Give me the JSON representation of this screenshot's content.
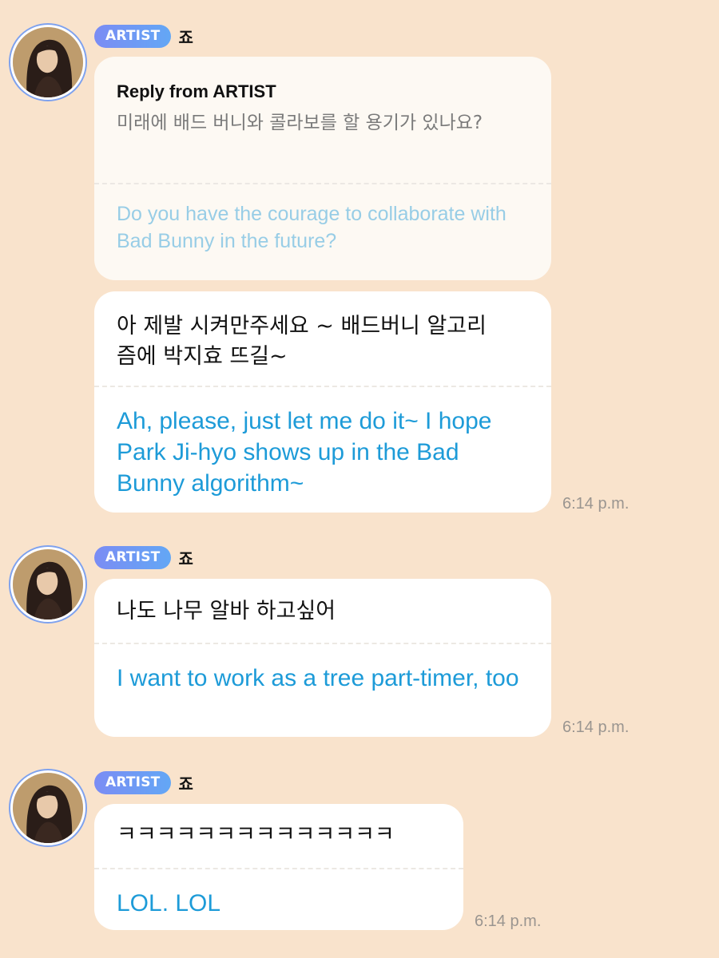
{
  "accent_colors": {
    "badge_start": "#7b8cf4",
    "badge_end": "#63a7f5",
    "translation_text": "#1d9bd8",
    "quoted_translation": "#98cde6",
    "background": "#f9e3cc"
  },
  "groups": [
    {
      "badge": "ARTIST",
      "name": "죠",
      "avatar_icon": "profile-photo",
      "reply": {
        "title": "Reply from ARTIST",
        "korean": "미래에 배드 버니와 콜라보를 할 용기가 있나요?",
        "english": "Do you have the courage to collaborate with Bad Bunny in the future?"
      },
      "message": {
        "korean": "아 제발 시켜만주세요 ~ 배드버니 알고리즘에 박지효 뜨길~",
        "english": "Ah, please, just let me do it~ I hope Park Ji-hyo shows up in the Bad Bunny algorithm~"
      },
      "time": "6:14 p.m."
    },
    {
      "badge": "ARTIST",
      "name": "죠",
      "avatar_icon": "profile-photo",
      "message": {
        "korean": "나도 나무 알바 하고싶어",
        "english": "I want to work as a tree part-timer, too"
      },
      "time": "6:14 p.m."
    },
    {
      "badge": "ARTIST",
      "name": "죠",
      "avatar_icon": "profile-photo",
      "message": {
        "korean": "ㅋㅋㅋㅋㅋㅋㅋㅋㅋㅋㅋㅋㅋㅋ",
        "english": "LOL. LOL"
      },
      "time": "6:14 p.m."
    }
  ]
}
